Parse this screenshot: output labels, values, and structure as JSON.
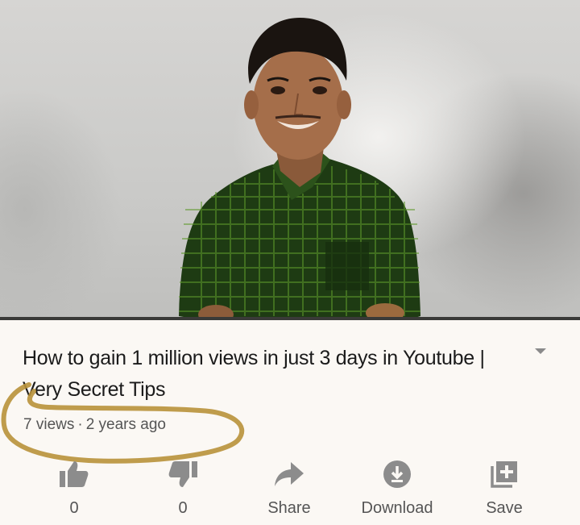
{
  "video": {
    "title": "How to gain 1 million views in just 3 days in Youtube | Very Secret Tips",
    "views": "7 views",
    "separator": "·",
    "age": "2 years ago"
  },
  "actions": {
    "like_count": "0",
    "dislike_count": "0",
    "share_label": "Share",
    "download_label": "Download",
    "save_label": "Save"
  },
  "icons": {
    "like": "thumbs-up-icon",
    "dislike": "thumbs-down-icon",
    "share": "share-arrow-icon",
    "download": "download-circle-icon",
    "save": "add-to-playlist-icon",
    "expand": "chevron-down-icon"
  },
  "colors": {
    "background": "#fbf8f4",
    "title": "#1b1b1b",
    "meta": "#555555",
    "icons": "#8c8c8c",
    "highlight_circle": "#b8913a",
    "shirt": "#1f3d14"
  }
}
